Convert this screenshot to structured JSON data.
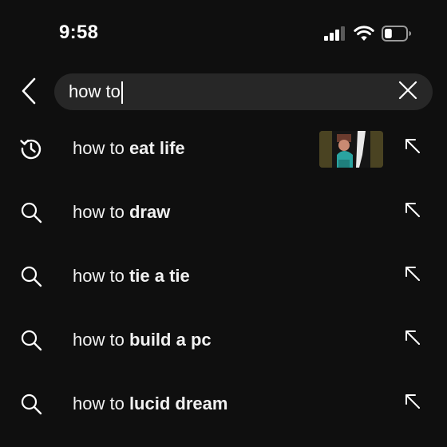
{
  "status_bar": {
    "time": "9:58",
    "signal_icon": "cellular-signal-icon",
    "wifi_icon": "wifi-icon",
    "battery_icon": "battery-icon",
    "battery_level": 0.35
  },
  "search": {
    "query": "how to",
    "back_icon": "chevron-left-icon",
    "clear_icon": "close-icon"
  },
  "suggestions": [
    {
      "type": "history",
      "icon": "history-icon",
      "prefix": "how to ",
      "completion": "eat life",
      "has_thumbnail": true
    },
    {
      "type": "search",
      "icon": "search-icon",
      "prefix": "how to ",
      "completion": "draw",
      "has_thumbnail": false
    },
    {
      "type": "search",
      "icon": "search-icon",
      "prefix": "how to ",
      "completion": "tie a tie",
      "has_thumbnail": false
    },
    {
      "type": "search",
      "icon": "search-icon",
      "prefix": "how to ",
      "completion": "build a pc",
      "has_thumbnail": false
    },
    {
      "type": "search",
      "icon": "search-icon",
      "prefix": "how to ",
      "completion": "lucid dream",
      "has_thumbnail": false
    }
  ],
  "colors": {
    "background": "#0f0f0f",
    "search_box": "#272727",
    "text": "#f1f1f1"
  }
}
